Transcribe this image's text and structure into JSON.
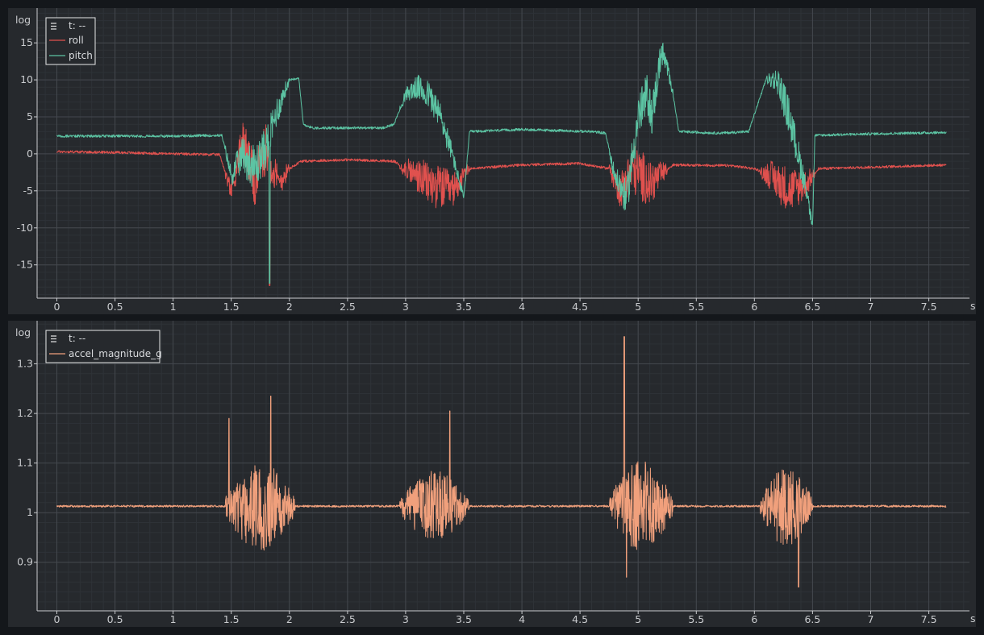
{
  "chart_data": [
    {
      "type": "line",
      "ylabel": "log",
      "xunit": "s",
      "xlim": [
        -0.17,
        7.85
      ],
      "ylim": [
        -19.5,
        19.7
      ],
      "x_ticks": [
        0,
        0.5,
        1,
        1.5,
        2,
        2.5,
        3,
        3.5,
        4,
        4.5,
        5,
        5.5,
        6,
        6.5,
        7,
        7.5
      ],
      "y_ticks": [
        15,
        10,
        5,
        0,
        -5,
        -10,
        -15
      ],
      "grid": true,
      "legend": {
        "placement": "top-left",
        "header": "t: --"
      },
      "series": [
        {
          "name": "roll",
          "color": "#e0514e",
          "keypoints": [
            [
              0,
              0.3
            ],
            [
              0.5,
              0.2
            ],
            [
              1,
              0
            ],
            [
              1.4,
              -0.1
            ],
            [
              1.5,
              -5
            ],
            [
              1.6,
              2
            ],
            [
              1.7,
              -4
            ],
            [
              1.8,
              1
            ],
            [
              1.9,
              -4
            ],
            [
              2,
              -2
            ],
            [
              2.1,
              -1
            ],
            [
              2.5,
              -0.8
            ],
            [
              2.9,
              -1
            ],
            [
              3,
              -2
            ],
            [
              3.2,
              -4
            ],
            [
              3.4,
              -5
            ],
            [
              3.55,
              -2
            ],
            [
              4,
              -1.5
            ],
            [
              4.5,
              -1.3
            ],
            [
              4.75,
              -2
            ],
            [
              4.85,
              -5
            ],
            [
              4.95,
              -2
            ],
            [
              5.1,
              -4
            ],
            [
              5.3,
              -1.5
            ],
            [
              5.8,
              -1.6
            ],
            [
              6,
              -2
            ],
            [
              6.15,
              -3
            ],
            [
              6.3,
              -5
            ],
            [
              6.45,
              -4
            ],
            [
              6.55,
              -2
            ],
            [
              7,
              -1.8
            ],
            [
              7.65,
              -1.5
            ]
          ],
          "bursts": [
            [
              1.45,
              2.0,
              3.5
            ],
            [
              2.95,
              3.55,
              3
            ],
            [
              4.75,
              5.25,
              3.5
            ],
            [
              6.05,
              6.52,
              3
            ]
          ]
        },
        {
          "name": "pitch",
          "color": "#5cc4a3",
          "keypoints": [
            [
              0,
              2.4
            ],
            [
              0.5,
              2.4
            ],
            [
              1,
              2.4
            ],
            [
              1.42,
              2.5
            ],
            [
              1.5,
              -3
            ],
            [
              1.6,
              0
            ],
            [
              1.7,
              -2
            ],
            [
              1.8,
              1
            ],
            [
              1.9,
              6
            ],
            [
              2,
              10
            ],
            [
              2.08,
              10.3
            ],
            [
              2.12,
              4
            ],
            [
              2.2,
              3.5
            ],
            [
              2.8,
              3.5
            ],
            [
              2.9,
              4
            ],
            [
              3,
              8
            ],
            [
              3.1,
              9
            ],
            [
              3.2,
              8
            ],
            [
              3.3,
              5
            ],
            [
              3.4,
              0
            ],
            [
              3.5,
              -6
            ],
            [
              3.55,
              3
            ],
            [
              4,
              3.3
            ],
            [
              4.6,
              3
            ],
            [
              4.72,
              2.8
            ],
            [
              4.8,
              -3
            ],
            [
              4.9,
              -6
            ],
            [
              5,
              5
            ],
            [
              5.08,
              8
            ],
            [
              5.12,
              5
            ],
            [
              5.2,
              14
            ],
            [
              5.28,
              10
            ],
            [
              5.35,
              3
            ],
            [
              5.7,
              2.8
            ],
            [
              5.95,
              3
            ],
            [
              6.1,
              10
            ],
            [
              6.2,
              10
            ],
            [
              6.3,
              5
            ],
            [
              6.45,
              -5
            ],
            [
              6.5,
              -10
            ],
            [
              6.52,
              2.5
            ],
            [
              7,
              2.7
            ],
            [
              7.65,
              2.9
            ]
          ],
          "bursts": [
            [
              1.45,
              2.0,
              3
            ],
            [
              2.95,
              3.5,
              2
            ],
            [
              4.75,
              5.3,
              3
            ],
            [
              6.1,
              6.5,
              2.5
            ]
          ]
        }
      ]
    },
    {
      "type": "line",
      "ylabel": "log",
      "xunit": "s",
      "xlim": [
        -0.17,
        7.85
      ],
      "ylim": [
        0.802,
        1.387
      ],
      "x_ticks": [
        0,
        0.5,
        1,
        1.5,
        2,
        2.5,
        3,
        3.5,
        4,
        4.5,
        5,
        5.5,
        6,
        6.5,
        7,
        7.5
      ],
      "y_ticks": [
        1.3,
        1.2,
        1.1,
        1.0,
        0.9
      ],
      "grid": true,
      "legend": {
        "placement": "top-left",
        "header": "t: --"
      },
      "series": [
        {
          "name": "accel_magnitude_g",
          "color": "#f0a07c",
          "baseline": 1.013,
          "bursts": [
            [
              1.45,
              2.05,
              0.09
            ],
            [
              2.95,
              3.55,
              0.07
            ],
            [
              4.75,
              5.3,
              0.09
            ],
            [
              6.05,
              6.5,
              0.08
            ]
          ],
          "spikes": [
            [
              1.48,
              1.19
            ],
            [
              1.84,
              1.235
            ],
            [
              3.38,
              1.205
            ],
            [
              4.88,
              1.355
            ],
            [
              4.9,
              0.87
            ],
            [
              6.38,
              0.85
            ]
          ]
        }
      ]
    }
  ]
}
